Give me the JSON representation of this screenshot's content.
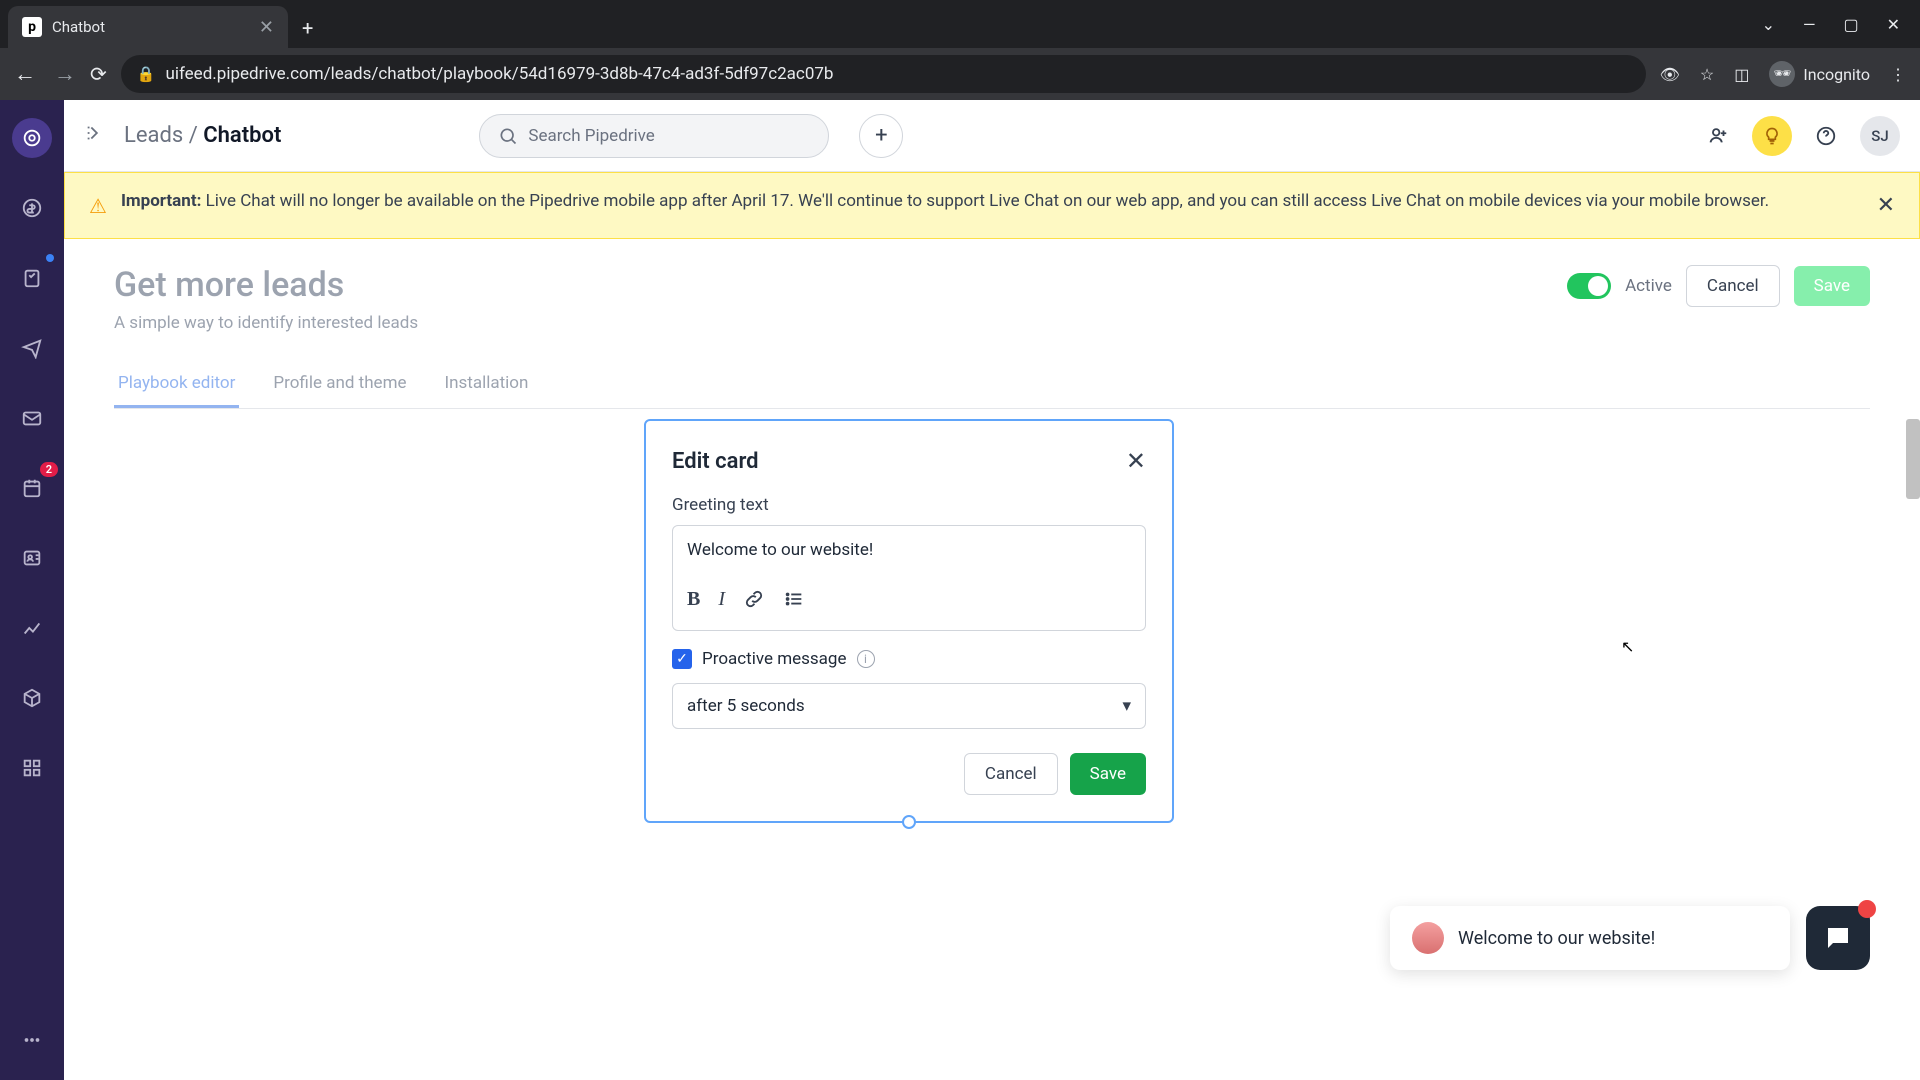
{
  "browser": {
    "tab_title": "Chatbot",
    "url": "uifeed.pipedrive.com/leads/chatbot/playbook/54d16979-3d8b-47c4-ad3f-5df97c2ac07b",
    "incognito_label": "Incognito"
  },
  "topbar": {
    "breadcrumb_parent": "Leads",
    "breadcrumb_sep": " / ",
    "breadcrumb_current": "Chatbot",
    "search_placeholder": "Search Pipedrive",
    "avatar_initials": "SJ"
  },
  "alert": {
    "prefix": "Important:",
    "text": " Live Chat will no longer be available on the Pipedrive mobile app after April 17. We'll continue to support Live Chat on our web app, and you can still access Live Chat on mobile devices via your mobile browser."
  },
  "page": {
    "title": "Get more leads",
    "subtitle": "A simple way to identify interested leads",
    "toggle_label": "Active",
    "cancel": "Cancel",
    "save": "Save"
  },
  "tabs": {
    "t0": "Playbook editor",
    "t1": "Profile and theme",
    "t2": "Installation"
  },
  "sidebar": {
    "badge_count": "2"
  },
  "card": {
    "title": "Edit card",
    "field_label": "Greeting text",
    "greeting_value": "Welcome to our website!",
    "checkbox_label": "Proactive message",
    "select_value": "after 5 seconds",
    "cancel": "Cancel",
    "save": "Save"
  },
  "chat": {
    "message": "Welcome to our website!"
  }
}
